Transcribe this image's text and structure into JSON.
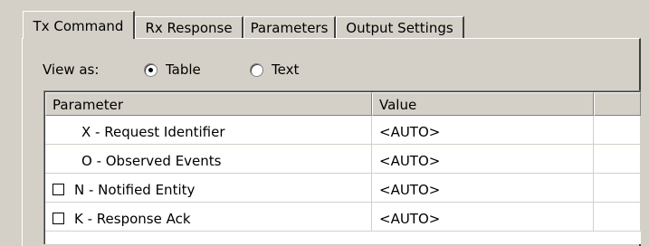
{
  "tabs": [
    "Tx Command",
    "Rx Response",
    "Parameters",
    "Output Settings"
  ],
  "view_as": {
    "label": "View as:",
    "options": [
      {
        "label": "Table",
        "checked": true
      },
      {
        "label": "Text",
        "checked": false
      }
    ]
  },
  "table": {
    "headers": [
      "Parameter",
      "Value"
    ],
    "rows": [
      {
        "has_checkbox": false,
        "checked": false,
        "parameter": "X - Request Identifier",
        "value": "<AUTO>"
      },
      {
        "has_checkbox": false,
        "checked": false,
        "parameter": "O - Observed Events",
        "value": "<AUTO>"
      },
      {
        "has_checkbox": true,
        "checked": false,
        "parameter": "N - Notified Entity",
        "value": "<AUTO>"
      },
      {
        "has_checkbox": true,
        "checked": false,
        "parameter": "K - Response Ack",
        "value": "<AUTO>"
      }
    ]
  }
}
